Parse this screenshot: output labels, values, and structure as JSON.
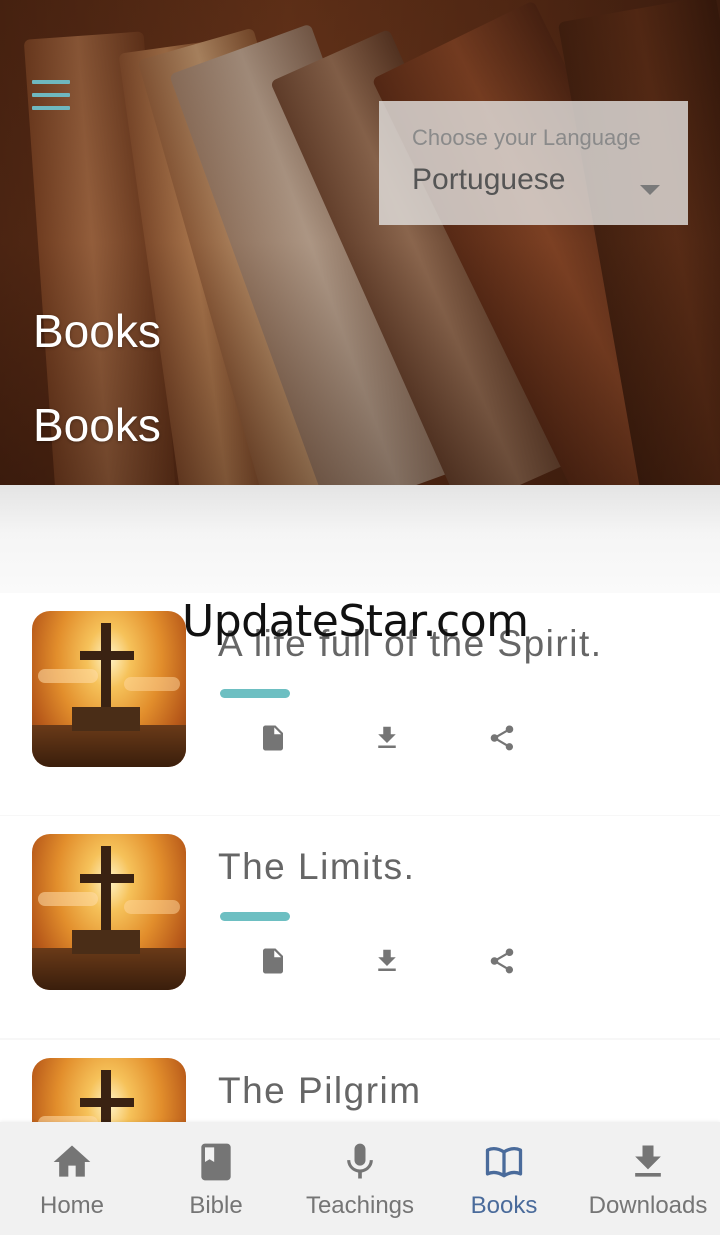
{
  "header": {
    "menu_icon": "hamburger-menu-icon",
    "language": {
      "label": "Choose your Language",
      "value": "Portuguese",
      "caret_icon": "dropdown-caret-icon"
    },
    "title_primary": "Books",
    "title_secondary": "Books"
  },
  "books": [
    {
      "title": "A life full of the Spirit.",
      "thumbnail_icon": "cross-sunset-image",
      "actions": [
        "document-icon",
        "download-icon",
        "share-icon"
      ]
    },
    {
      "title": "The Limits.",
      "thumbnail_icon": "cross-sunset-image",
      "actions": [
        "document-icon",
        "download-icon",
        "share-icon"
      ]
    },
    {
      "title": "The Pilgrim",
      "thumbnail_icon": "cross-sunset-image",
      "actions": []
    }
  ],
  "watermark": "UpdateStar.com",
  "bottom_nav": {
    "items": [
      {
        "label": "Home",
        "icon": "home-icon"
      },
      {
        "label": "Bible",
        "icon": "bible-icon"
      },
      {
        "label": "Teachings",
        "icon": "microphone-icon"
      },
      {
        "label": "Books",
        "icon": "open-book-icon"
      },
      {
        "label": "Downloads",
        "icon": "download-icon"
      }
    ],
    "active": "Books"
  },
  "colors": {
    "accent": "#6dbfc2",
    "menu_icon": "#6fb8bf",
    "nav_active": "#4a6b9b",
    "nav_inactive": "#757575",
    "title_text": "#666666"
  }
}
